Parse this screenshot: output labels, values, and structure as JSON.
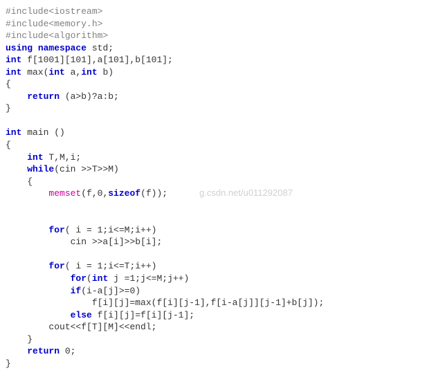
{
  "watermark": "g.csdn.net/u011292087",
  "code": {
    "lines": [
      {
        "indent": 0,
        "tokens": [
          {
            "t": "#include<iostream>",
            "c": "pp"
          }
        ]
      },
      {
        "indent": 0,
        "tokens": [
          {
            "t": "#include<memory.h>",
            "c": "pp"
          }
        ]
      },
      {
        "indent": 0,
        "tokens": [
          {
            "t": "#include<algorithm>",
            "c": "pp"
          }
        ]
      },
      {
        "indent": 0,
        "tokens": [
          {
            "t": "using",
            "c": "kw"
          },
          {
            "t": " "
          },
          {
            "t": "namespace",
            "c": "kw"
          },
          {
            "t": " std;"
          }
        ]
      },
      {
        "indent": 0,
        "tokens": [
          {
            "t": "int",
            "c": "kw"
          },
          {
            "t": " f[1001][101],a[101],b[101];"
          }
        ]
      },
      {
        "indent": 0,
        "tokens": [
          {
            "t": "int",
            "c": "kw"
          },
          {
            "t": " max("
          },
          {
            "t": "int",
            "c": "kw"
          },
          {
            "t": " a,"
          },
          {
            "t": "int",
            "c": "kw"
          },
          {
            "t": " b)"
          }
        ]
      },
      {
        "indent": 0,
        "tokens": [
          {
            "t": "{"
          }
        ]
      },
      {
        "indent": 1,
        "tokens": [
          {
            "t": "return",
            "c": "kw"
          },
          {
            "t": " (a>b)?a:b;"
          }
        ]
      },
      {
        "indent": 0,
        "tokens": [
          {
            "t": "}"
          }
        ]
      },
      {
        "indent": 0,
        "tokens": [
          {
            "t": ""
          }
        ]
      },
      {
        "indent": 0,
        "tokens": [
          {
            "t": "int",
            "c": "kw"
          },
          {
            "t": " main ()"
          }
        ]
      },
      {
        "indent": 0,
        "tokens": [
          {
            "t": "{"
          }
        ]
      },
      {
        "indent": 1,
        "tokens": [
          {
            "t": "int",
            "c": "kw"
          },
          {
            "t": " T,M,i;"
          }
        ]
      },
      {
        "indent": 1,
        "tokens": [
          {
            "t": "while",
            "c": "kw"
          },
          {
            "t": "(cin >>T>>M)"
          }
        ]
      },
      {
        "indent": 1,
        "tokens": [
          {
            "t": "{"
          }
        ]
      },
      {
        "indent": 2,
        "tokens": [
          {
            "t": "memset",
            "c": "fn"
          },
          {
            "t": "(f,0,"
          },
          {
            "t": "sizeof",
            "c": "kw"
          },
          {
            "t": "(f));"
          }
        ]
      },
      {
        "indent": 0,
        "tokens": [
          {
            "t": ""
          }
        ]
      },
      {
        "indent": 0,
        "tokens": [
          {
            "t": ""
          }
        ]
      },
      {
        "indent": 2,
        "tokens": [
          {
            "t": "for",
            "c": "kw"
          },
          {
            "t": "( i = 1;i<=M;i++)"
          }
        ]
      },
      {
        "indent": 3,
        "tokens": [
          {
            "t": "cin >>a[i]>>b[i];"
          }
        ]
      },
      {
        "indent": 0,
        "tokens": [
          {
            "t": ""
          }
        ]
      },
      {
        "indent": 2,
        "tokens": [
          {
            "t": "for",
            "c": "kw"
          },
          {
            "t": "( i = 1;i<=T;i++)"
          }
        ]
      },
      {
        "indent": 3,
        "tokens": [
          {
            "t": "for",
            "c": "kw"
          },
          {
            "t": "("
          },
          {
            "t": "int",
            "c": "kw"
          },
          {
            "t": " j =1;j<=M;j++)"
          }
        ]
      },
      {
        "indent": 3,
        "tokens": [
          {
            "t": "if",
            "c": "kw"
          },
          {
            "t": "(i-a[j]>=0)"
          }
        ]
      },
      {
        "indent": 4,
        "tokens": [
          {
            "t": "f[i][j]=max(f[i][j-1],f[i-a[j]][j-1]+b[j]);"
          }
        ]
      },
      {
        "indent": 3,
        "tokens": [
          {
            "t": "else",
            "c": "kw"
          },
          {
            "t": " f[i][j]=f[i][j-1];"
          }
        ]
      },
      {
        "indent": 2,
        "tokens": [
          {
            "t": "cout<<f[T][M]<<endl;"
          }
        ]
      },
      {
        "indent": 1,
        "tokens": [
          {
            "t": "}"
          }
        ]
      },
      {
        "indent": 1,
        "tokens": [
          {
            "t": "return",
            "c": "kw"
          },
          {
            "t": " 0;"
          }
        ]
      },
      {
        "indent": 0,
        "tokens": [
          {
            "t": "}"
          }
        ]
      }
    ]
  }
}
